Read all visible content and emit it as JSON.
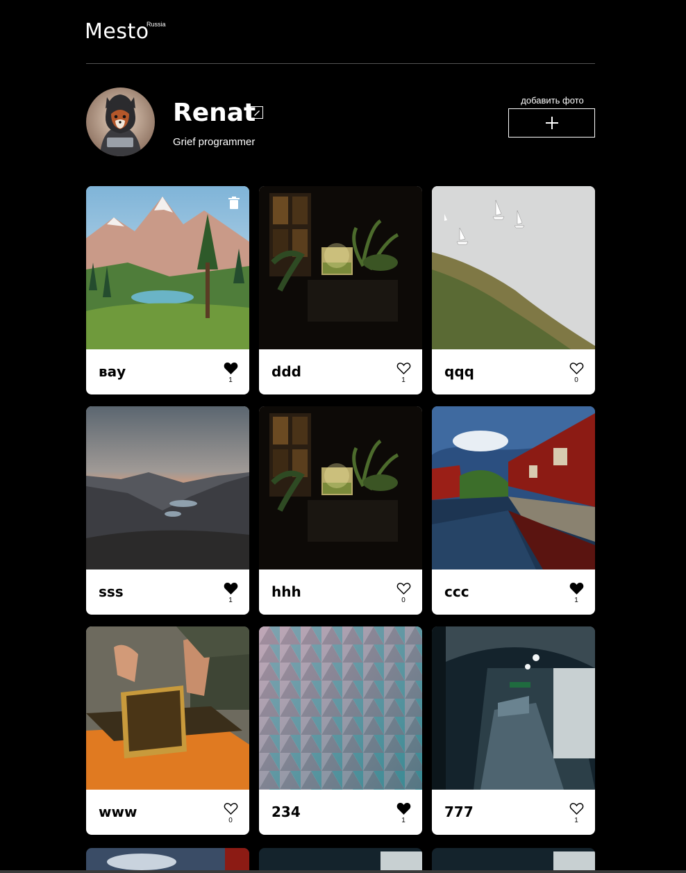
{
  "header": {
    "logo": "Mesto",
    "logo_sup": "Russia"
  },
  "profile": {
    "name": "Renat",
    "about": "Grief programmer",
    "add_label": "добавить фото"
  },
  "cards": [
    {
      "title": "вау",
      "likes": "1",
      "liked": true
    },
    {
      "title": "ddd",
      "likes": "1",
      "liked": false
    },
    {
      "title": "qqq",
      "likes": "0",
      "liked": false
    },
    {
      "title": "sss",
      "likes": "1",
      "liked": true
    },
    {
      "title": "hhh",
      "likes": "0",
      "liked": false
    },
    {
      "title": "ccc",
      "likes": "1",
      "liked": true
    },
    {
      "title": "www",
      "likes": "0",
      "liked": false
    },
    {
      "title": "234",
      "likes": "1",
      "liked": true
    },
    {
      "title": "777",
      "likes": "1",
      "liked": false
    }
  ],
  "colors": {
    "background": "#000000",
    "card": "#ffffff",
    "divider": "#545454"
  }
}
